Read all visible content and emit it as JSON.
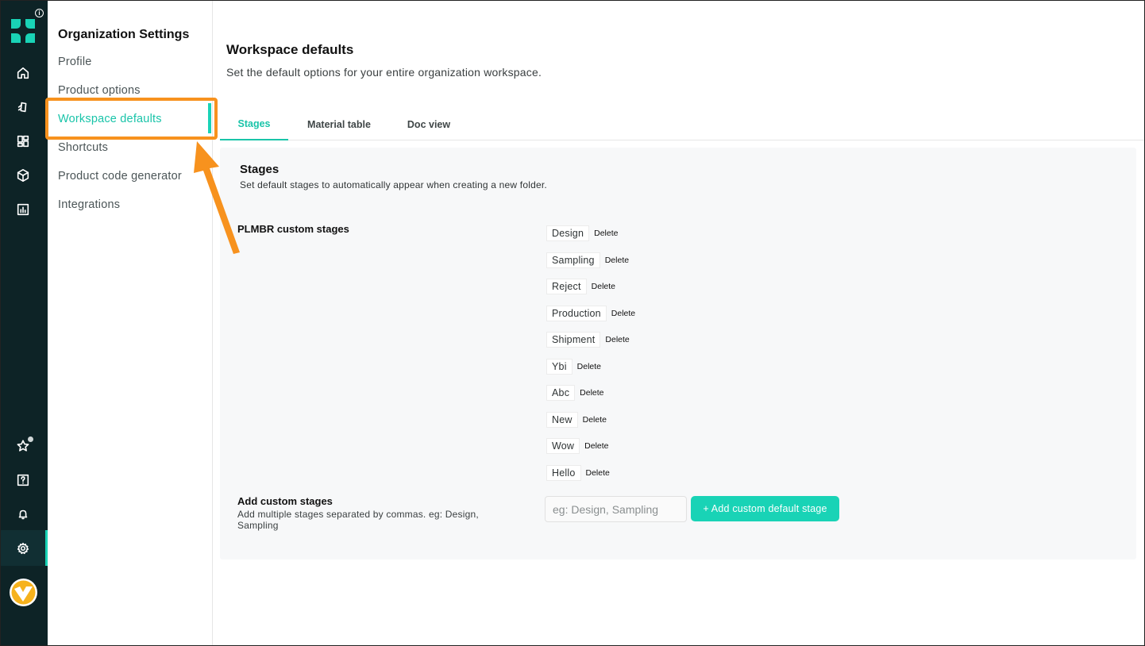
{
  "rail": {
    "icons": [
      "logo-icon",
      "info-icon",
      "home-icon",
      "tag-icon",
      "dashboard-icon",
      "box-icon",
      "chart-icon",
      "star-icon",
      "help-icon",
      "bell-icon",
      "settings-icon",
      "avatar"
    ],
    "info_glyph": "i",
    "accent_color": "#19d3b6"
  },
  "nav": {
    "title": "Organization Settings",
    "items": [
      "Profile",
      "Product options",
      "Workspace defaults",
      "Shortcuts",
      "Product code generator",
      "Integrations"
    ],
    "active_index": 2
  },
  "main": {
    "title": "Workspace defaults",
    "subtitle": "Set the default options for your entire organization workspace.",
    "tabs": [
      "Stages",
      "Material table",
      "Doc view"
    ],
    "active_tab": "Stages"
  },
  "stages_panel": {
    "title": "Stages",
    "subtitle": "Set default stages to automatically appear when creating a new folder.",
    "custom_label": "PLMBR custom stages",
    "stages": [
      "Design",
      "Sampling",
      "Reject",
      "Production",
      "Shipment",
      "Ybi",
      "Abc",
      "New",
      "Wow",
      "Hello"
    ],
    "delete_label": "Delete",
    "add_label": "Add custom stages",
    "add_help": "Add multiple stages separated by commas. eg: Design, Sampling",
    "input_placeholder": "eg: Design, Sampling",
    "input_value": "",
    "add_button": "+ Add custom default stage"
  },
  "annotation": {
    "color": "#f7921e"
  }
}
